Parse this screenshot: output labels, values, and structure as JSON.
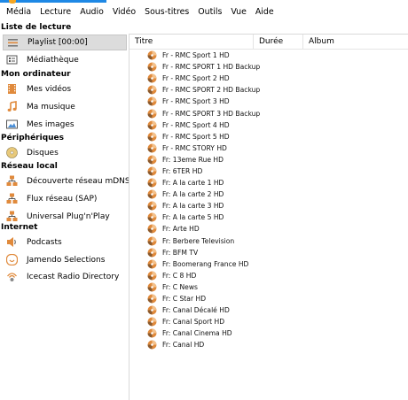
{
  "menu": [
    "Média",
    "Lecture",
    "Audio",
    "Vidéo",
    "Sous-titres",
    "Outils",
    "Vue",
    "Aide"
  ],
  "sidebar": {
    "sections": [
      {
        "title": "Liste de lecture",
        "items": [
          {
            "label": "Playlist [00:00]",
            "icon": "playlist-icon",
            "selected": true
          },
          {
            "label": "Médiathèque",
            "icon": "media-library-icon"
          }
        ]
      },
      {
        "title": "Mon ordinateur",
        "items": [
          {
            "label": "Mes vidéos",
            "icon": "film-icon"
          },
          {
            "label": "Ma musique",
            "icon": "music-note-icon"
          },
          {
            "label": "Mes images",
            "icon": "image-icon"
          }
        ]
      },
      {
        "title": "Périphériques",
        "items": [
          {
            "label": "Disques",
            "icon": "disc-icon"
          }
        ]
      },
      {
        "title": "Réseau local",
        "items": [
          {
            "label": "Découverte réseau mDNS",
            "icon": "network-icon"
          },
          {
            "label": "Flux réseau (SAP)",
            "icon": "network-icon"
          },
          {
            "label": "Universal Plug'n'Play",
            "icon": "network-icon"
          }
        ]
      },
      {
        "title": "Internet",
        "items": [
          {
            "label": "Podcasts",
            "icon": "podcast-icon"
          },
          {
            "label": "Jamendo Selections",
            "icon": "jamendo-icon"
          },
          {
            "label": "Icecast Radio Directory",
            "icon": "icecast-icon"
          }
        ]
      }
    ]
  },
  "playlist": {
    "columns": {
      "title": "Titre",
      "duration": "Durée",
      "album": "Album"
    },
    "rows": [
      "Fr - RMC Sport 1 HD",
      "Fr - RMC SPORT 1 HD Backup",
      "Fr - RMC Sport 2 HD",
      "Fr - RMC SPORT 2 HD Backup",
      "Fr - RMC Sport 3 HD",
      "Fr - RMC SPORT 3 HD Backup",
      "Fr - RMC Sport 4 HD",
      "Fr - RMC Sport 5 HD",
      "Fr - RMC STORY HD",
      "Fr: 13eme Rue HD",
      "Fr: 6TER HD",
      "Fr: A la carte 1 HD",
      "Fr: A la carte 2 HD",
      "Fr: A la carte 3 HD",
      "Fr: A la carte 5 HD",
      "Fr: Arte HD",
      "Fr: Berbere Television",
      "Fr: BFM TV",
      "Fr: Boomerang France HD",
      "Fr: C 8 HD",
      "Fr: C News",
      "Fr: C Star HD",
      "Fr: Canal  Décalé HD",
      "Fr: Canal  Sport HD",
      "Fr: Canal  Cinema HD",
      "Fr: Canal  HD"
    ]
  },
  "colors": {
    "accent": "#1e88e5",
    "selected_bg": "#dcdcdc",
    "disc": "#e08a3c"
  }
}
